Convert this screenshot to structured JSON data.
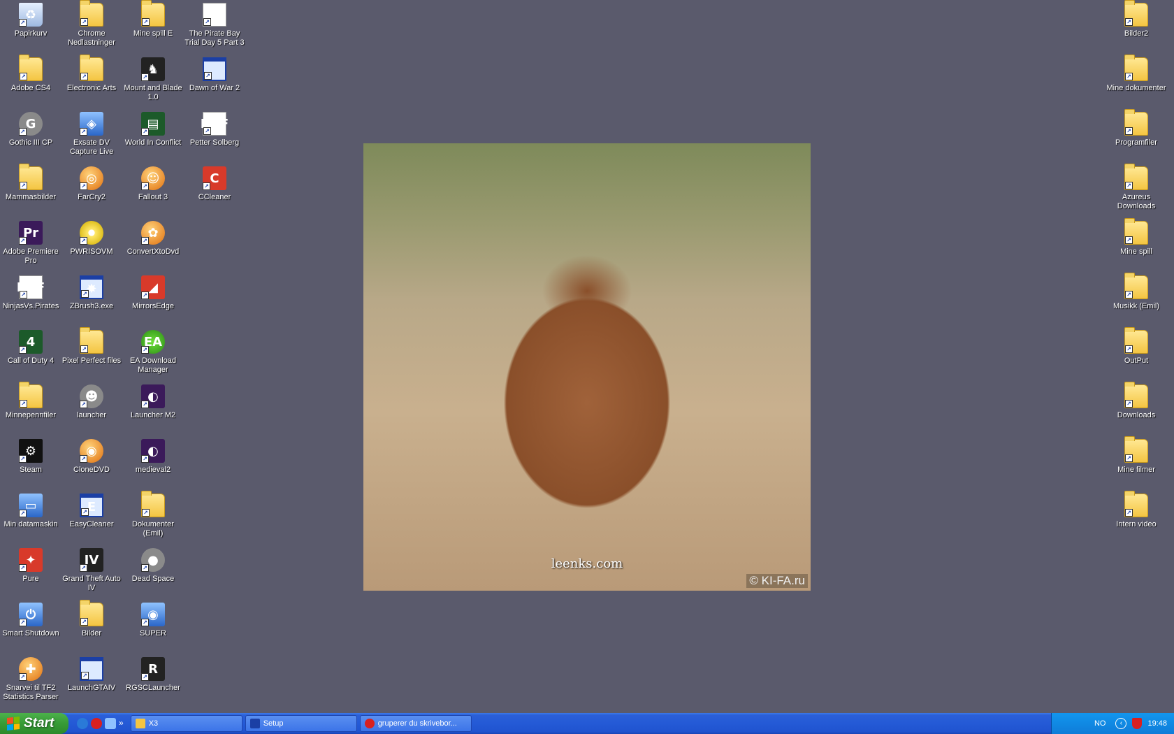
{
  "desktop": {
    "col1": [
      {
        "label": "Papirkurv",
        "glyph": "recycle",
        "ch": "♻"
      },
      {
        "label": "Adobe CS4",
        "glyph": "folder",
        "ch": ""
      },
      {
        "label": "Gothic III CP",
        "glyph": "gray",
        "ch": "G"
      },
      {
        "label": "Mammasbilder",
        "glyph": "folder",
        "ch": ""
      },
      {
        "label": "Adobe Premiere Pro",
        "glyph": "purple",
        "ch": "Pr"
      },
      {
        "label": "NinjasVs.Pirates",
        "glyph": "pdf",
        "ch": "PDF"
      },
      {
        "label": "Call of Duty 4",
        "glyph": "green",
        "ch": "4"
      },
      {
        "label": "Minnepennfiler",
        "glyph": "folder",
        "ch": ""
      },
      {
        "label": "Steam",
        "glyph": "steam",
        "ch": "⚙"
      },
      {
        "label": "Min datamaskin",
        "glyph": "blue",
        "ch": "▭"
      },
      {
        "label": "Pure",
        "glyph": "red",
        "ch": "✦"
      },
      {
        "label": "Smart Shutdown",
        "glyph": "blue",
        "ch": "⏻"
      },
      {
        "label": "Snarvei til TF2 Statistics Parser",
        "glyph": "orb",
        "ch": "✚"
      }
    ],
    "col2": [
      {
        "label": "Chrome Nedlastninger",
        "glyph": "folder",
        "ch": ""
      },
      {
        "label": "Electronic Arts",
        "glyph": "folder",
        "ch": ""
      },
      {
        "label": "Exsate DV Capture Live",
        "glyph": "blue",
        "ch": "◈"
      },
      {
        "label": "FarCry2",
        "glyph": "orb",
        "ch": "◎"
      },
      {
        "label": "PWRISOVM",
        "glyph": "disc",
        "ch": ""
      },
      {
        "label": "ZBrush3.exe",
        "glyph": "app",
        "ch": "✸"
      },
      {
        "label": "Pixel Perfect files",
        "glyph": "folder",
        "ch": ""
      },
      {
        "label": "launcher",
        "glyph": "gray",
        "ch": "☻"
      },
      {
        "label": "CloneDVD",
        "glyph": "orb",
        "ch": "◉"
      },
      {
        "label": "EasyCleaner",
        "glyph": "app",
        "ch": "E"
      },
      {
        "label": "Grand Theft Auto IV",
        "glyph": "dark",
        "ch": "IV"
      },
      {
        "label": "Bilder",
        "glyph": "folder",
        "ch": ""
      },
      {
        "label": "LaunchGTAIV",
        "glyph": "app",
        "ch": ""
      }
    ],
    "col3": [
      {
        "label": "Mine spill E",
        "glyph": "folder",
        "ch": ""
      },
      {
        "label": "Mount and Blade 1.0",
        "glyph": "dark",
        "ch": "♞"
      },
      {
        "label": "World In Conflict",
        "glyph": "green",
        "ch": "▤"
      },
      {
        "label": "Fallout 3",
        "glyph": "orb",
        "ch": "☺"
      },
      {
        "label": "ConvertXtoDvd",
        "glyph": "orb",
        "ch": "✿"
      },
      {
        "label": "MirrorsEdge",
        "glyph": "red",
        "ch": "◢"
      },
      {
        "label": "EA Download Manager",
        "glyph": "ea",
        "ch": "EA"
      },
      {
        "label": "Launcher M2",
        "glyph": "purple",
        "ch": "◐"
      },
      {
        "label": "medieval2",
        "glyph": "purple",
        "ch": "◐"
      },
      {
        "label": "Dokumenter (Emil)",
        "glyph": "folder",
        "ch": ""
      },
      {
        "label": "Dead Space",
        "glyph": "gray",
        "ch": "●"
      },
      {
        "label": "SUPER",
        "glyph": "blue",
        "ch": "◉"
      },
      {
        "label": "RGSCLauncher",
        "glyph": "dark",
        "ch": "R"
      }
    ],
    "col4": [
      {
        "label": "The Pirate Bay Trial Day 5 Part 3",
        "glyph": "mp3",
        "ch": "♪"
      },
      {
        "label": "Dawn of War 2",
        "glyph": "app",
        "ch": ""
      },
      {
        "label": "Petter Solberg",
        "glyph": "pdf",
        "ch": "PDF"
      },
      {
        "label": "CCleaner",
        "glyph": "red",
        "ch": "C"
      }
    ],
    "right": [
      {
        "label": "Bilder2",
        "glyph": "folder",
        "ch": ""
      },
      {
        "label": "Mine dokumenter",
        "glyph": "folder",
        "ch": ""
      },
      {
        "label": "Programfiler",
        "glyph": "folder",
        "ch": ""
      },
      {
        "label": "Azureus Downloads",
        "glyph": "folder",
        "ch": ""
      },
      {
        "label": "Mine spill",
        "glyph": "folder",
        "ch": ""
      },
      {
        "label": "Musikk (Emil)",
        "glyph": "folder",
        "ch": ""
      },
      {
        "label": "OutPut",
        "glyph": "folder",
        "ch": ""
      },
      {
        "label": "Downloads",
        "glyph": "folder",
        "ch": ""
      },
      {
        "label": "Mine filmer",
        "glyph": "folder",
        "ch": ""
      },
      {
        "label": "Intern video",
        "glyph": "folder",
        "ch": ""
      }
    ]
  },
  "wallpaper": {
    "site_text": "leenks.com",
    "copyright_text": "© KI-FA.ru"
  },
  "taskbar": {
    "start_label": "Start",
    "quick_more": "»",
    "tasks": [
      {
        "label": "X3",
        "icon_color": "#f4c542"
      },
      {
        "label": "Setup",
        "icon_color": "#1b3fa5"
      },
      {
        "label": "gruperer du skrivebor...",
        "icon_color": "#d82020"
      }
    ],
    "tray": {
      "language": "NO",
      "chevron": "‹",
      "clock": "19:48"
    }
  }
}
